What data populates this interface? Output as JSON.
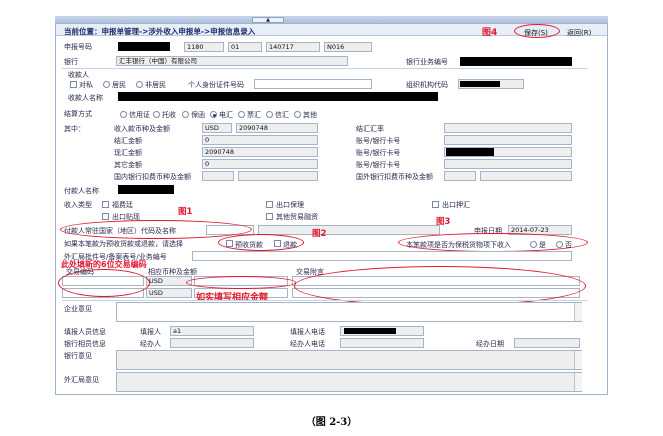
{
  "header": {
    "breadcrumb": "当前位置：申报单管理->涉外收入申报单->申报信息录入",
    "tag4": "图4",
    "save_label": "保存(S)",
    "back_label": "返回(R)",
    "collapse_glyph": "▲"
  },
  "form": {
    "declaration_no_label": "申报号码",
    "declaration_parts": [
      "1180",
      "01",
      "140717",
      "N016"
    ],
    "bank_label": "银行",
    "bank_value": "汇丰银行（中国）有限公司",
    "bank_biz_no_label": "银行业务编号",
    "payee_section": "收款人",
    "payee_type_options": [
      "对私",
      "居民",
      "非居民"
    ],
    "id_no_label": "个人身份证件号码",
    "org_code_label": "组织机构代码",
    "payee_name_label": "收款人名称",
    "settlement_label": "结算方式",
    "settlement_options": [
      "信用证",
      "托收",
      "保函",
      "电汇",
      "票汇",
      "信汇",
      "其他"
    ],
    "settlement_selected": "电汇",
    "among_label": "其中：",
    "amount_rows": [
      {
        "label": "收入款币种及金额",
        "currency": "USD",
        "amount": "2090748",
        "right_label": "结汇汇率"
      },
      {
        "label": "结汇金额",
        "amount": "0",
        "right_label": "账号/银行卡号"
      },
      {
        "label": "现汇金额",
        "amount": "2090748",
        "right_label": "账号/银行卡号"
      },
      {
        "label": "其它金额",
        "amount": "0",
        "right_label": "账号/银行卡号"
      },
      {
        "label": "国内银行扣费币种及金额",
        "right_label": "国外银行扣费币种及金额"
      }
    ],
    "payer_name_label": "付款人名称",
    "receipt_type_label": "收入类型",
    "receipt_types": [
      "福费廷",
      "出口保理",
      "出口押汇",
      "出口贴现",
      "其他贸易融资"
    ],
    "tag1": "图1",
    "tag2": "图2",
    "tag3": "图3",
    "payer_country_label": "付款人常驻国家（地区）代码及名称",
    "declare_date_label": "申报日期",
    "declare_date_value": "2014-07-23",
    "refund_question": "如果本笔款为预收货款或退款，请选择",
    "prepay_label": "预收货款",
    "refund_label": "退款",
    "bonded_question": "本笔款项是否为保税货物项下收入",
    "yes_label": "是",
    "no_label": "否",
    "approval_label": "外汇局批件号/备案表号/业务编号",
    "tx_code_label": "交易编码",
    "currency_amount_label": "相应币种及金额",
    "tx_note_label": "交易附言",
    "tx_currencies": [
      "USD",
      "USD"
    ],
    "annot_tx_code": "此处填新的6位交易编码",
    "annot_amount": "如实填写相应金额",
    "enterprise_opinion_label": "企业意见",
    "filler_info_label": "填报人员信息",
    "filler_label": "填报人",
    "filler_value": "a1",
    "filler_phone_label": "填报人电话",
    "bank_staff_label": "银行相员信息",
    "handler_label": "经办人",
    "handler_phone_label": "经办人电话",
    "handle_date_label": "经办日期",
    "bank_opinion_label": "银行意见",
    "safe_opinion_label": "外汇局意见"
  },
  "caption": "（图 2-3）"
}
